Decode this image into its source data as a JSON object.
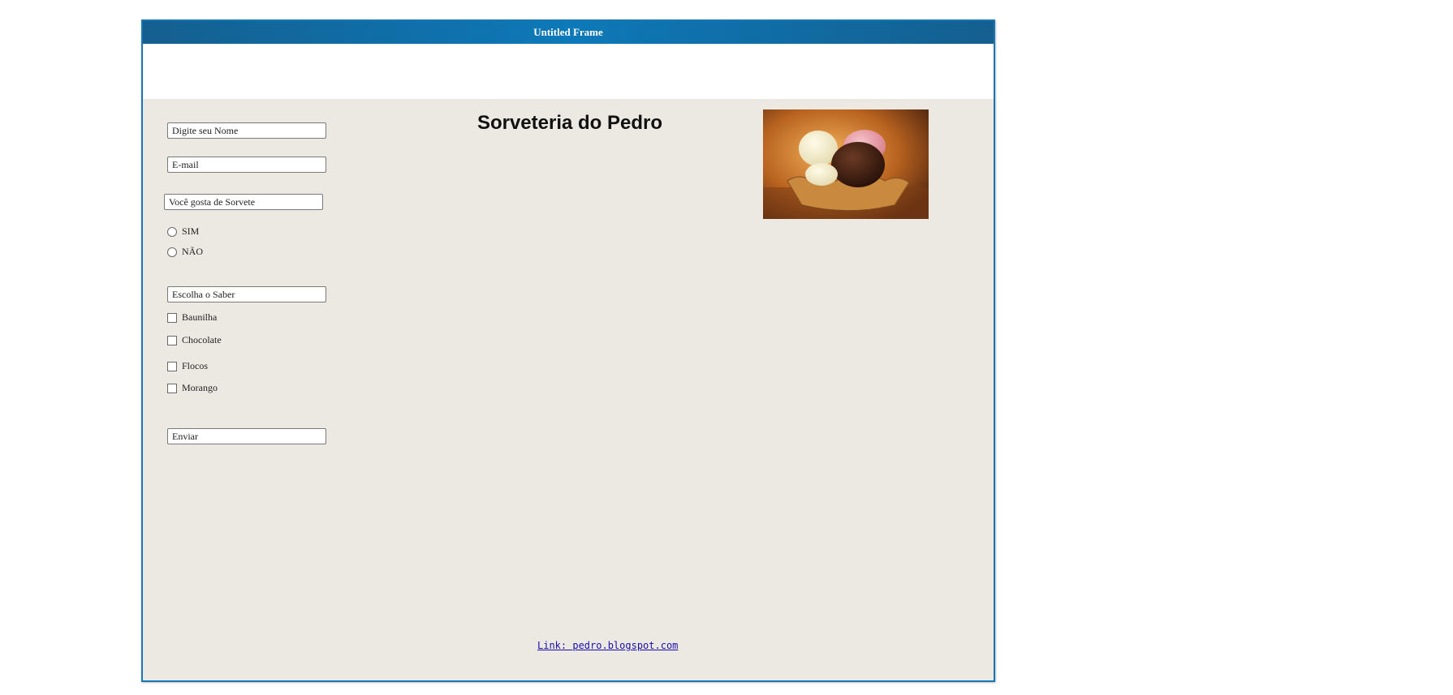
{
  "window": {
    "title": "Untitled Frame"
  },
  "form": {
    "name_field": "Digite seu Nome",
    "email_field": "E-mail",
    "question_field": "Você gosta de Sorvete",
    "radios": [
      {
        "label": "SIM",
        "checked": false
      },
      {
        "label": "NÃO",
        "checked": false
      }
    ],
    "flavor_field": "Escolha o Saber",
    "checkboxes": [
      {
        "label": "Baunilha",
        "checked": false
      },
      {
        "label": "Chocolate",
        "checked": false
      },
      {
        "label": "Flocos",
        "checked": false
      },
      {
        "label": "Morango",
        "checked": false
      }
    ],
    "submit_field": "Enviar"
  },
  "header": {
    "title": "Sorveteria do Pedro"
  },
  "image": {
    "subject": "ice-cream-bowl-photo"
  },
  "footer": {
    "link_text": "Link: pedro.blogspot.com"
  },
  "colors": {
    "titlebar": "#0d79b8",
    "border": "#1677b3",
    "panel": "#ece9e3",
    "link": "#1a0dab"
  }
}
